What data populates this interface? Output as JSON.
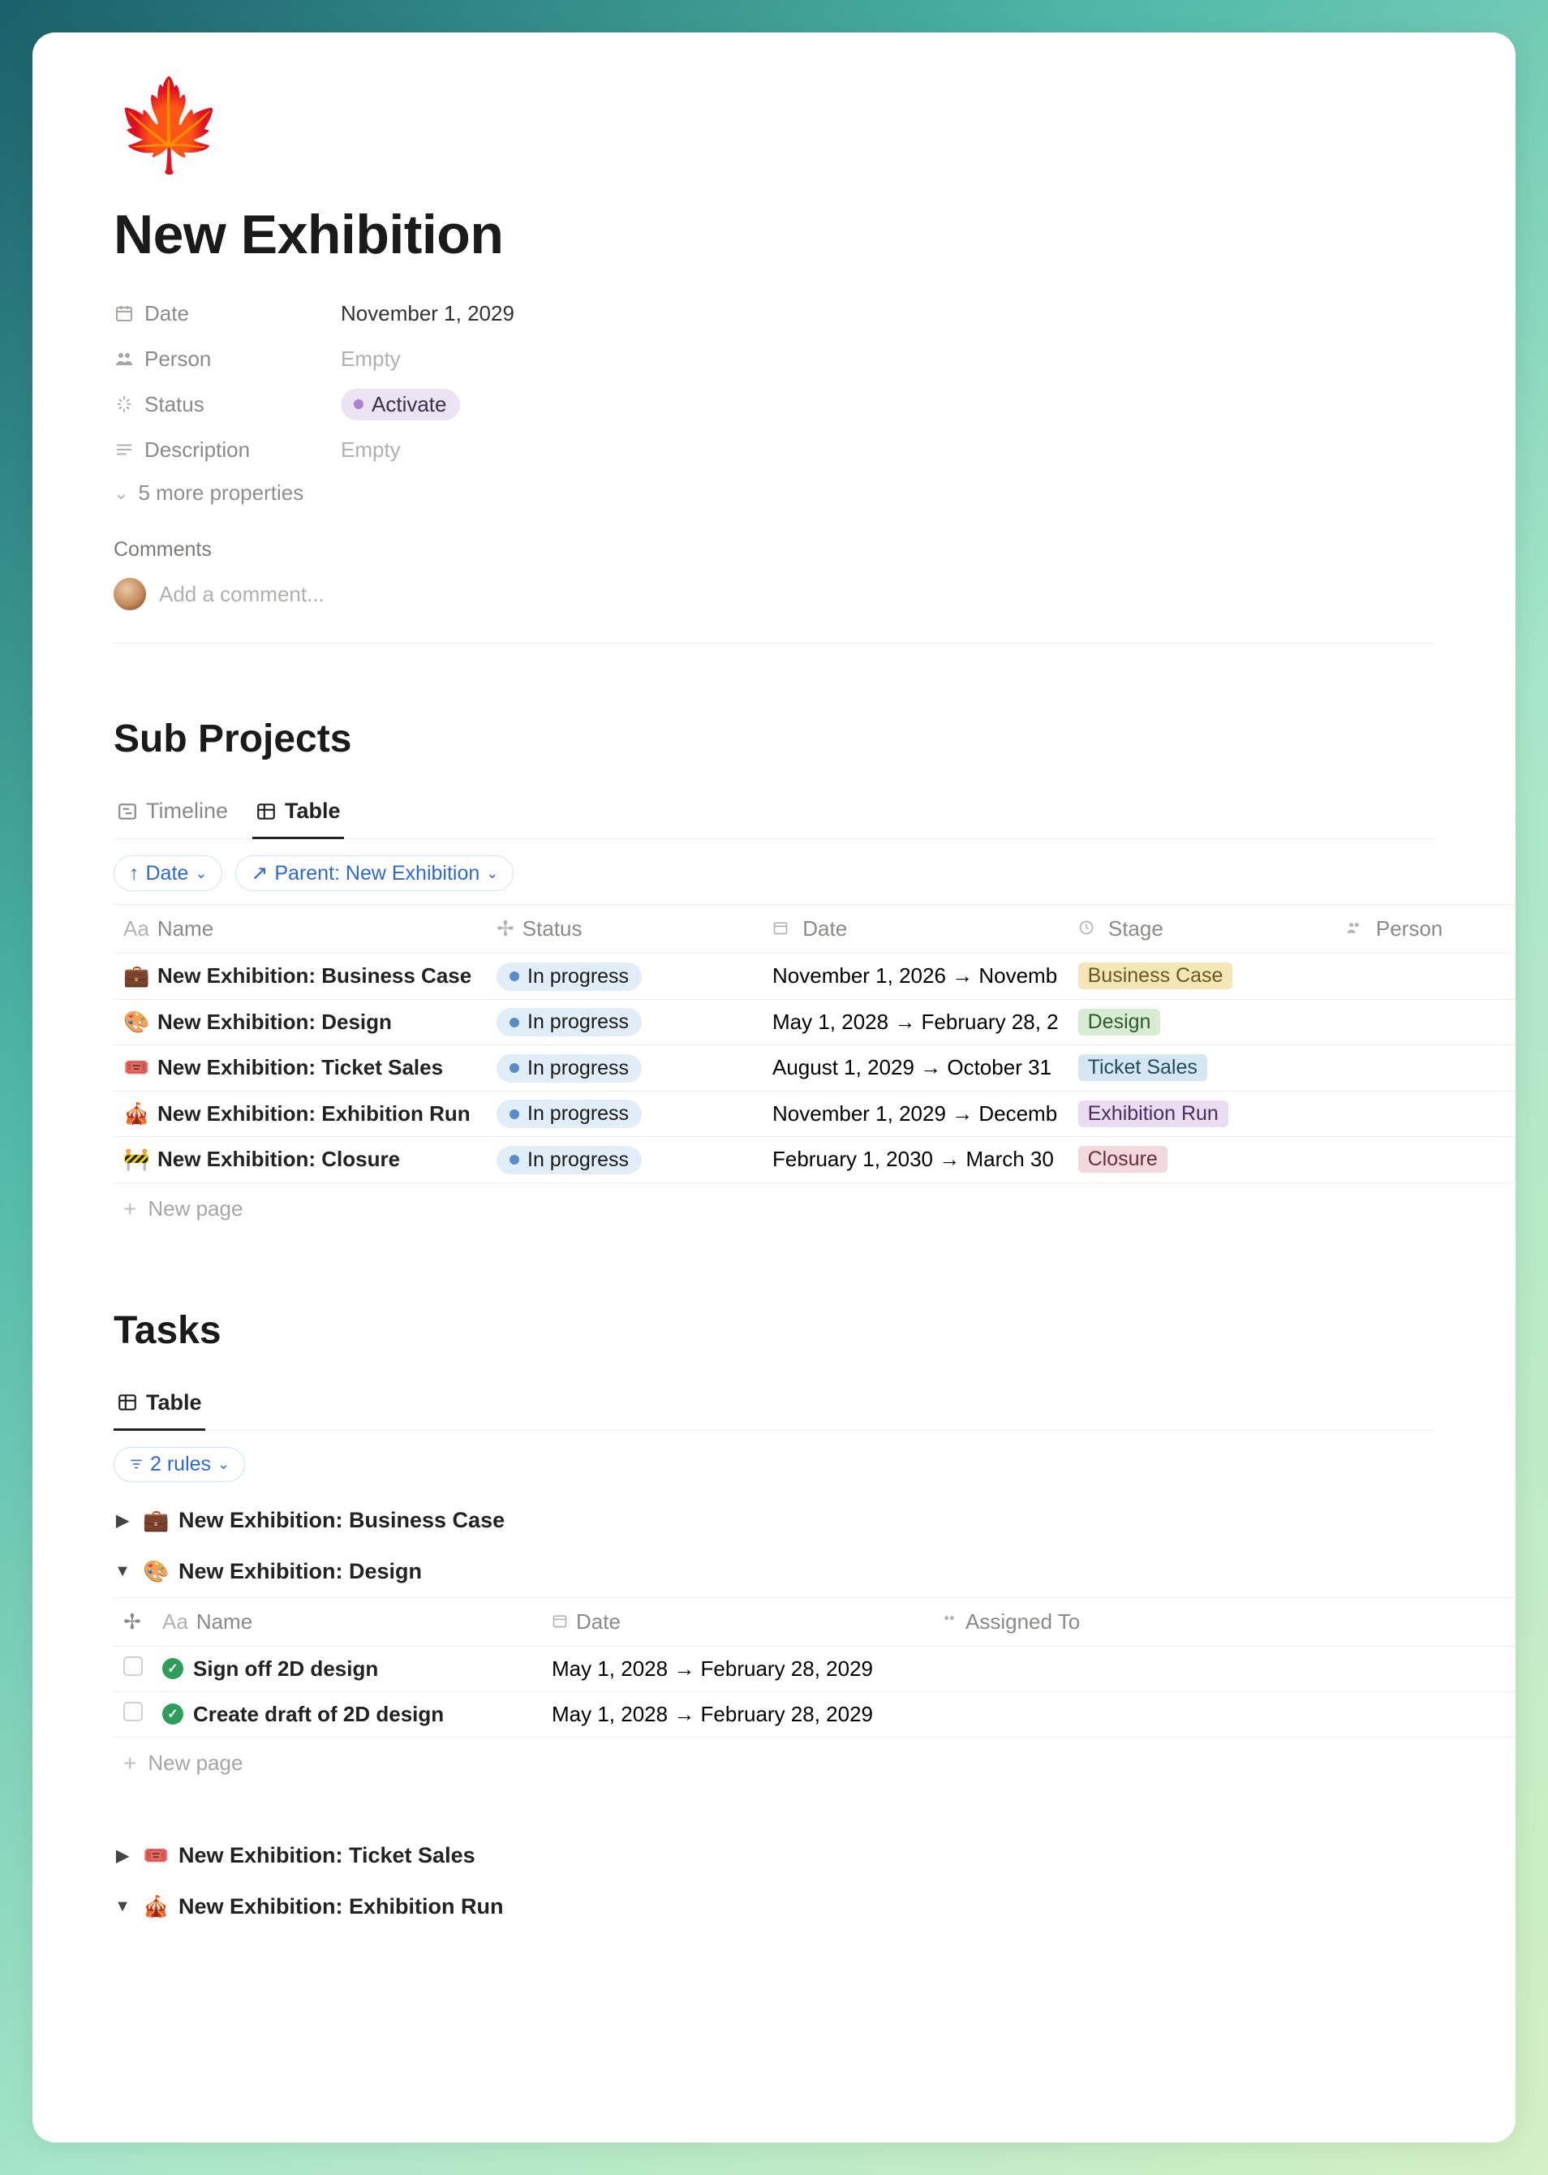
{
  "hero_icon": "🍁",
  "title": "New Exhibition",
  "properties": {
    "date_label": "Date",
    "date_value": "November 1, 2029",
    "person_label": "Person",
    "person_value": "Empty",
    "status_label": "Status",
    "status_value": "Activate",
    "description_label": "Description",
    "description_value": "Empty",
    "more": "5 more properties"
  },
  "comments": {
    "heading": "Comments",
    "placeholder": "Add a comment..."
  },
  "subprojects": {
    "heading": "Sub Projects",
    "tabs": {
      "timeline": "Timeline",
      "table": "Table"
    },
    "filters": {
      "date": "Date",
      "parent": "Parent: New Exhibition"
    },
    "columns": {
      "name": "Name",
      "status": "Status",
      "date": "Date",
      "stage": "Stage",
      "person": "Person"
    },
    "rows": [
      {
        "emoji": "💼",
        "name": "New Exhibition: Business Case",
        "status": "In progress",
        "date": "November 1, 2026 → Novemb",
        "stage": "Business Case",
        "stage_class": "stage-bc"
      },
      {
        "emoji": "🎨",
        "name": "New Exhibition: Design",
        "status": "In progress",
        "date": "May 1, 2028 → February 28, 2",
        "stage": "Design",
        "stage_class": "stage-design"
      },
      {
        "emoji": "🎟️",
        "name": "New Exhibition: Ticket Sales",
        "status": "In progress",
        "date": "August 1, 2029 → October 31",
        "stage": "Ticket Sales",
        "stage_class": "stage-ticket"
      },
      {
        "emoji": "🎪",
        "name": "New Exhibition: Exhibition Run",
        "status": "In progress",
        "date": "November 1, 2029 → Decemb",
        "stage": "Exhibition Run",
        "stage_class": "stage-run"
      },
      {
        "emoji": "🚧",
        "name": "New Exhibition: Closure",
        "status": "In progress",
        "date": "February 1, 2030 → March 30",
        "stage": "Closure",
        "stage_class": "stage-closure"
      }
    ],
    "new_page": "New page"
  },
  "tasks": {
    "heading": "Tasks",
    "tab": "Table",
    "rules_filter": "2 rules",
    "columns": {
      "name": "Name",
      "date": "Date",
      "assigned": "Assigned To"
    },
    "groups": [
      {
        "emoji": "💼",
        "title": "New Exhibition: Business Case",
        "open": false
      },
      {
        "emoji": "🎨",
        "title": "New Exhibition: Design",
        "open": true,
        "rows": [
          {
            "name": "Sign off 2D design",
            "date": "May 1, 2028 → February 28, 2029"
          },
          {
            "name": "Create draft of 2D design",
            "date": "May 1, 2028 → February 28, 2029"
          }
        ]
      },
      {
        "emoji": "🎟️",
        "title": "New Exhibition: Ticket Sales",
        "open": false
      },
      {
        "emoji": "🎪",
        "title": "New Exhibition: Exhibition Run",
        "open": true
      }
    ],
    "new_page": "New page"
  }
}
